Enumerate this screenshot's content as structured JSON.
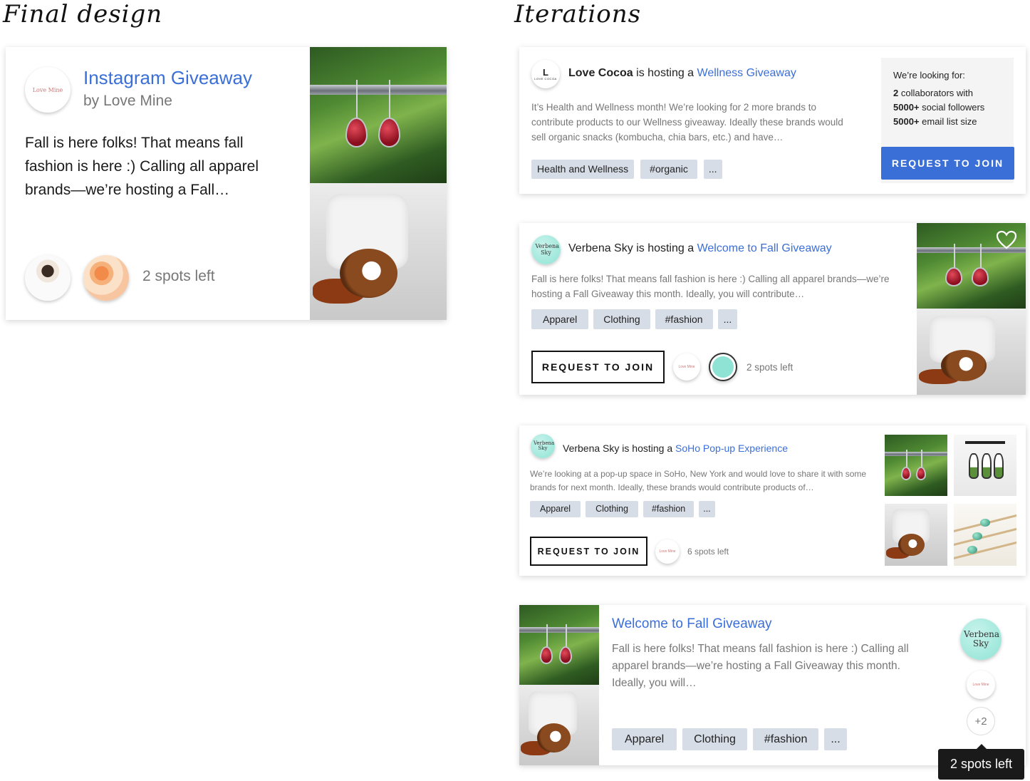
{
  "headings": {
    "final": "Final design",
    "iterations": "Iterations"
  },
  "final_card": {
    "title": "Instagram Giveaway",
    "byline": "by Love Mine",
    "logo_text": "Love Mine",
    "body": "Fall is here folks! That means fall fashion is here :) Calling all apparel brands—we’re hosting a Fall…",
    "spots": "2 spots left"
  },
  "card1": {
    "host": "Love Cocoa",
    "hosting_text": "is hosting a",
    "event": "Wellness Giveaway",
    "logo_text": "LOVE COCOA",
    "body": "It’s Health and Wellness month! We’re looking for 2 more brands to contribute products to our Wellness giveaway. Ideally these brands would sell organic snacks (kombucha, chia bars, etc.) and have…",
    "tags": [
      "Health and Wellness",
      "#organic",
      "..."
    ],
    "looking_for": "We’re looking for:",
    "req1_bold": "2",
    "req1": "collaborators with",
    "req2_bold": "5000+",
    "req2": "social followers",
    "req3_bold": "5000+",
    "req3": "email list size",
    "button": "REQUEST TO JOIN"
  },
  "card2": {
    "host": "Verbena Sky",
    "hosting_text": "is hosting a",
    "event": "Welcome to Fall Giveaway",
    "logo_text": "Verbena Sky",
    "body": "Fall is here folks! That means fall fashion is here :) Calling all apparel brands—we’re hosting a Fall Giveaway this month. Ideally, you will contribute…",
    "tags": [
      "Apparel",
      "Clothing",
      "#fashion",
      "..."
    ],
    "button": "REQUEST TO JOIN",
    "spots": "2 spots left"
  },
  "card3": {
    "host": "Verbena Sky",
    "hosting_text": "is hosting a",
    "event": "SoHo Pop-up Experience",
    "logo_text": "Verbena Sky",
    "body": "We’re looking at a pop-up space in SoHo, New York and would love to share it with some brands for next month. Ideally,  these brands would contribute products of…",
    "tags": [
      "Apparel",
      "Clothing",
      "#fashion",
      "..."
    ],
    "button": "REQUEST TO JOIN",
    "spots": "6 spots left"
  },
  "card4": {
    "title": "Welcome to Fall Giveaway",
    "body": "Fall is here folks! That means fall fashion is here :) Calling all apparel brands—we’re hosting a Fall Giveaway this month. Ideally, you will…",
    "tags": [
      "Apparel",
      "Clothing",
      "#fashion",
      "..."
    ],
    "logo_text": "Verbena Sky",
    "more": "+2",
    "tooltip": "2 spots left"
  },
  "colors": {
    "accent": "#3b6fd8",
    "tag_bg": "#d7dde7",
    "mint": "#8fe3d4"
  }
}
